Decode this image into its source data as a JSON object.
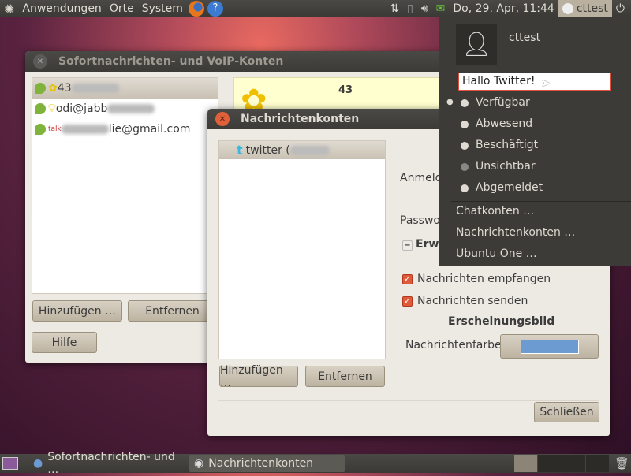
{
  "top_panel": {
    "menus": [
      "Anwendungen",
      "Orte",
      "System"
    ],
    "clock": "Do, 29. Apr, 11:44",
    "user": "cttest"
  },
  "win_im": {
    "title": "Sofortnachrichten- und VoIP-Konten",
    "accounts": [
      {
        "name": "43"
      },
      {
        "name": "odi@jabb"
      },
      {
        "name": "lie@gmail.com"
      }
    ],
    "detail_name": "43",
    "add": "Hinzufügen …",
    "remove": "Entfernen",
    "help": "Hilfe"
  },
  "win_msg": {
    "title": "Nachrichtenkonten",
    "account": "twitter (",
    "login_label": "Anmeld",
    "password_label": "Passwo",
    "advanced_label": "Erw",
    "receive": "Nachrichten empfangen",
    "send": "Nachrichten senden",
    "appearance": "Erscheinungsbild",
    "color_label": "Nachrichtenfarbe",
    "color_value": "#6c9bd2",
    "add": "Hinzufügen …",
    "remove": "Entfernen",
    "close": "Schließen"
  },
  "menu": {
    "user": "cttest",
    "status_input": "Hallo Twitter!",
    "statuses": [
      "Verfügbar",
      "Abwesend",
      "Beschäftigt",
      "Unsichtbar",
      "Abgemeldet"
    ],
    "links": [
      "Chatkonten …",
      "Nachrichtenkonten …",
      "Ubuntu One …"
    ]
  },
  "taskbar": {
    "items": [
      "Sofortnachrichten- und …",
      "Nachrichtenkonten"
    ]
  }
}
